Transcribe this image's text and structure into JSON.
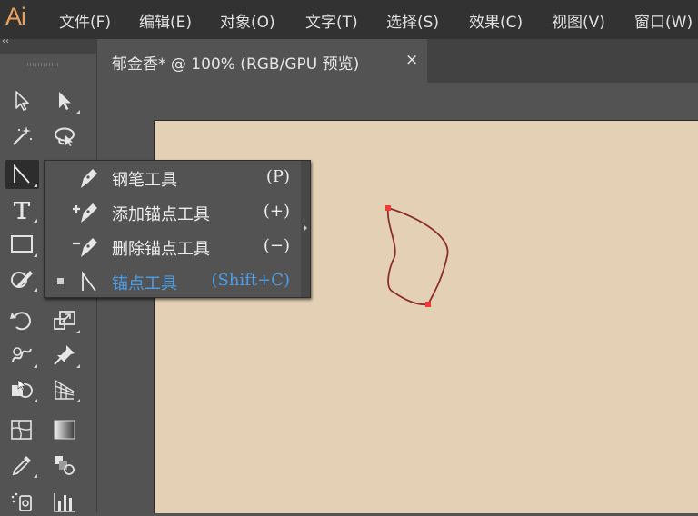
{
  "app": {
    "logo": "Ai"
  },
  "menu": {
    "items": [
      "文件(F)",
      "编辑(E)",
      "对象(O)",
      "文字(T)",
      "选择(S)",
      "效果(C)",
      "视图(V)",
      "窗口(W)"
    ]
  },
  "toolbar": {
    "collapse_glyph": "‹‹",
    "tools": [
      {
        "name": "selection-tool",
        "icon": "arrow-outline-icon"
      },
      {
        "name": "direct-selection-tool",
        "icon": "arrow-filled-icon"
      },
      {
        "name": "magic-wand-tool",
        "icon": "magic-wand-icon"
      },
      {
        "name": "lasso-tool",
        "icon": "lasso-icon"
      },
      {
        "name": "anchor-point-tool",
        "icon": "anchor-point-icon",
        "active": true
      },
      {
        "name": "type-tool",
        "icon": "type-icon"
      },
      {
        "name": "rectangle-tool",
        "icon": "rectangle-icon"
      },
      {
        "name": "shaper-tool",
        "icon": "shaper-icon"
      },
      {
        "name": "rotate-tool",
        "icon": "rotate-icon"
      },
      {
        "name": "scale-tool",
        "icon": "scale-icon"
      },
      {
        "name": "warp-tool",
        "icon": "warp-icon"
      },
      {
        "name": "puppet-warp-tool",
        "icon": "pin-icon"
      },
      {
        "name": "shape-builder-tool",
        "icon": "shape-builder-icon"
      },
      {
        "name": "perspective-grid-tool",
        "icon": "perspective-grid-icon"
      },
      {
        "name": "mesh-tool",
        "icon": "mesh-icon"
      },
      {
        "name": "gradient-tool",
        "icon": "gradient-icon"
      },
      {
        "name": "eyedropper-tool",
        "icon": "eyedropper-icon"
      },
      {
        "name": "blend-tool",
        "icon": "blend-icon"
      },
      {
        "name": "symbol-sprayer-tool",
        "icon": "symbol-sprayer-icon"
      },
      {
        "name": "column-graph-tool",
        "icon": "column-graph-icon"
      }
    ]
  },
  "document": {
    "tab_title": "郁金香* @ 100% (RGB/GPU 预览)",
    "close_glyph": "×"
  },
  "flyout": {
    "items": [
      {
        "label": "钢笔工具",
        "shortcut": "(P)",
        "icon": "pen-icon"
      },
      {
        "label": "添加锚点工具",
        "shortcut": "(+)",
        "icon": "add-anchor-point-icon"
      },
      {
        "label": "删除锚点工具",
        "shortcut": "(−)",
        "icon": "delete-anchor-point-icon"
      },
      {
        "label": "锚点工具",
        "shortcut": "(Shift+C)",
        "icon": "anchor-point-icon",
        "selected": true
      }
    ]
  },
  "colors": {
    "menubar": "#323232",
    "workspace": "#535353",
    "artboard": "#e4d1b5",
    "logo": "#e9a25c",
    "selected_text": "#4c9ee8",
    "path_stroke": "#8b2c31",
    "anchor_point": "#ef3a3a"
  }
}
